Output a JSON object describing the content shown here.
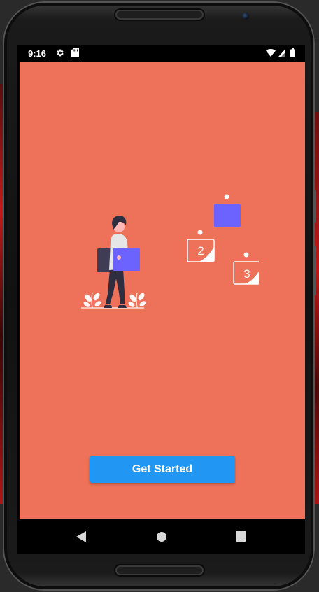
{
  "status_bar": {
    "time": "9:16",
    "icons": [
      "settings-gear-icon",
      "sd-card-icon",
      "wifi-icon",
      "cell-signal-icon",
      "battery-icon"
    ]
  },
  "app": {
    "background_color": "#ee7159",
    "illustration": {
      "box_labels": [
        "2",
        "3"
      ],
      "accent_color": "#6c63ff"
    },
    "primary_button": {
      "label": "Get Started",
      "color": "#2196f3"
    }
  },
  "nav_bar": {
    "icons": [
      "back-triangle-icon",
      "home-circle-icon",
      "recents-square-icon"
    ]
  }
}
